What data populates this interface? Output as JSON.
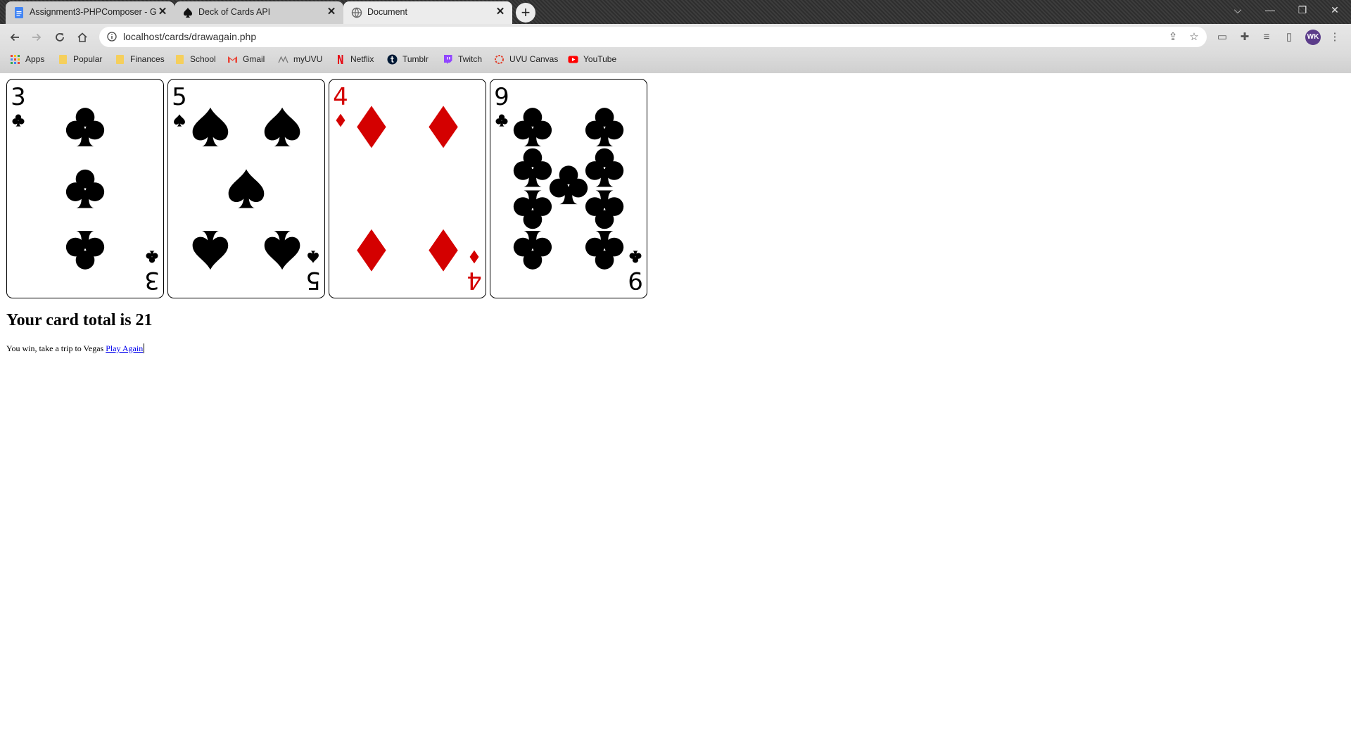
{
  "tabs": [
    {
      "title": "Assignment3-PHPComposer - Go",
      "icon": "docs-icon",
      "close": "✕"
    },
    {
      "title": "Deck of Cards API",
      "icon": "spade-icon",
      "close": "✕"
    },
    {
      "title": "Document",
      "icon": "globe-icon",
      "close": "✕"
    }
  ],
  "newtab_symbol": "+",
  "window_controls": {
    "tab_search": "⌵",
    "minimize": "—",
    "restore": "❐",
    "close": "✕"
  },
  "address": {
    "url": "localhost/cards/drawagain.php"
  },
  "bookmarks": [
    {
      "label": "Apps",
      "icon": "apps-grid-icon"
    },
    {
      "label": "Popular",
      "icon": "folder-icon"
    },
    {
      "label": "Finances",
      "icon": "folder-icon"
    },
    {
      "label": "School",
      "icon": "folder-icon"
    },
    {
      "label": "Gmail",
      "icon": "gmail-icon"
    },
    {
      "label": "myUVU",
      "icon": "myuvu-icon"
    },
    {
      "label": "Netflix",
      "icon": "netflix-icon"
    },
    {
      "label": "Tumblr",
      "icon": "tumblr-icon"
    },
    {
      "label": "Twitch",
      "icon": "twitch-icon"
    },
    {
      "label": "UVU Canvas",
      "icon": "canvas-icon"
    },
    {
      "label": "YouTube",
      "icon": "youtube-icon"
    }
  ],
  "profile_initials": "WK",
  "cards": [
    {
      "rank": "3",
      "suit": "clubs",
      "color": "#000000"
    },
    {
      "rank": "5",
      "suit": "spades",
      "color": "#000000"
    },
    {
      "rank": "4",
      "suit": "diamonds",
      "color": "#d40000"
    },
    {
      "rank": "9",
      "suit": "clubs",
      "color": "#000000"
    }
  ],
  "result": {
    "heading": "Your card total is 21",
    "message": "You win, take a trip to Vegas",
    "link": "Play Again"
  }
}
